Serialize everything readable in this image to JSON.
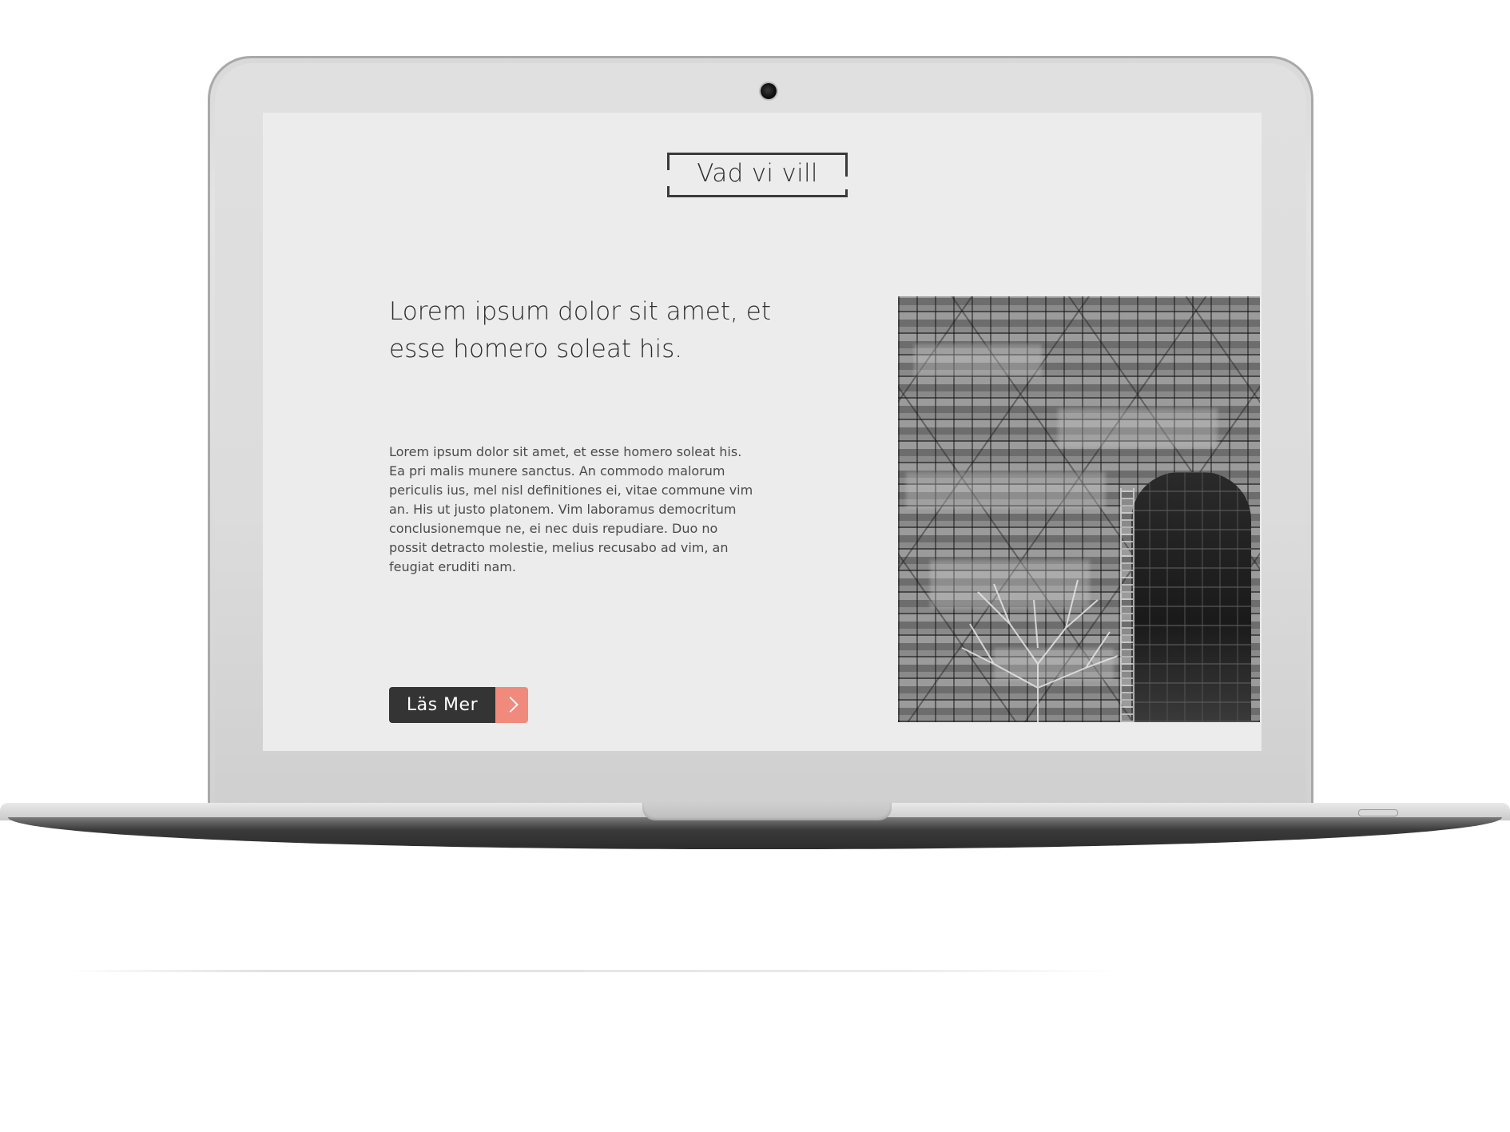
{
  "section": {
    "title": "Vad vi vill"
  },
  "content": {
    "headline": "Lorem ipsum dolor sit amet, et esse homero soleat his.",
    "body": "Lorem ipsum dolor sit amet, et esse homero soleat his. Ea pri malis munere sanctus. An commodo malorum periculis ius, mel nisl definitiones ei, vitae commune vim an. His ut justo platonem. Vim laboramus democritum conclusionemque ne, ei nec duis repudiare. Duo no possit detracto molestie, melius recusabo ad vim, an feugiat eruditi nam."
  },
  "cta": {
    "label": "Läs Mer",
    "icon": "chevron-right-icon"
  },
  "image": {
    "icon": "scaffolding-building-photo"
  },
  "colors": {
    "screen_bg": "#ececec",
    "button_dark": "#343434",
    "button_accent": "#ef8a7d",
    "text_dark": "#2b2b2b"
  }
}
